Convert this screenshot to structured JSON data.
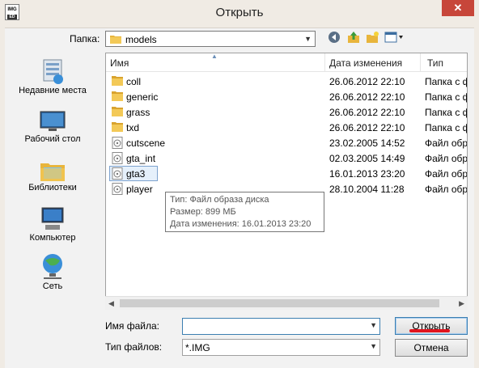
{
  "window": {
    "title": "Открыть",
    "close_glyph": "✕",
    "app_icon_text": "IMG",
    "app_icon_subtext": "ED"
  },
  "lookin": {
    "label": "Папка:",
    "value": "models"
  },
  "places": [
    {
      "label": "Недавние места",
      "icon": "recent-places-icon"
    },
    {
      "label": "Рабочий стол",
      "icon": "desktop-icon"
    },
    {
      "label": "Библиотеки",
      "icon": "libraries-icon"
    },
    {
      "label": "Компьютер",
      "icon": "computer-icon"
    },
    {
      "label": "Сеть",
      "icon": "network-icon"
    }
  ],
  "columns": {
    "name": "Имя",
    "date": "Дата изменения",
    "type": "Тип"
  },
  "files": [
    {
      "name": "coll",
      "date": "26.06.2012 22:10",
      "type": "Папка с ф",
      "kind": "folder"
    },
    {
      "name": "generic",
      "date": "26.06.2012 22:10",
      "type": "Папка с ф",
      "kind": "folder"
    },
    {
      "name": "grass",
      "date": "26.06.2012 22:10",
      "type": "Папка с ф",
      "kind": "folder"
    },
    {
      "name": "txd",
      "date": "26.06.2012 22:10",
      "type": "Папка с ф",
      "kind": "folder"
    },
    {
      "name": "cutscene",
      "date": "23.02.2005 14:52",
      "type": "Файл обр",
      "kind": "disk-image"
    },
    {
      "name": "gta_int",
      "date": "02.03.2005 14:49",
      "type": "Файл обр",
      "kind": "disk-image"
    },
    {
      "name": "gta3",
      "date": "16.01.2013 23:20",
      "type": "Файл обр",
      "kind": "disk-image",
      "selected": true
    },
    {
      "name": "player",
      "date": "28.10.2004 11:28",
      "type": "Файл обр",
      "kind": "disk-image"
    }
  ],
  "tooltip": {
    "line1": "Тип: Файл образа диска",
    "line2": "Размер: 899 МБ",
    "line3": "Дата изменения: 16.01.2013 23:20"
  },
  "filename": {
    "label": "Имя файла:",
    "value": ""
  },
  "filetype": {
    "label": "Тип файлов:",
    "value": "*.IMG"
  },
  "buttons": {
    "open": "Открыть",
    "cancel": "Отмена"
  },
  "colors": {
    "folder": "#e8b53c",
    "accent": "#3c7fb1",
    "close": "#c7463a",
    "annotation": "#e0141e"
  }
}
